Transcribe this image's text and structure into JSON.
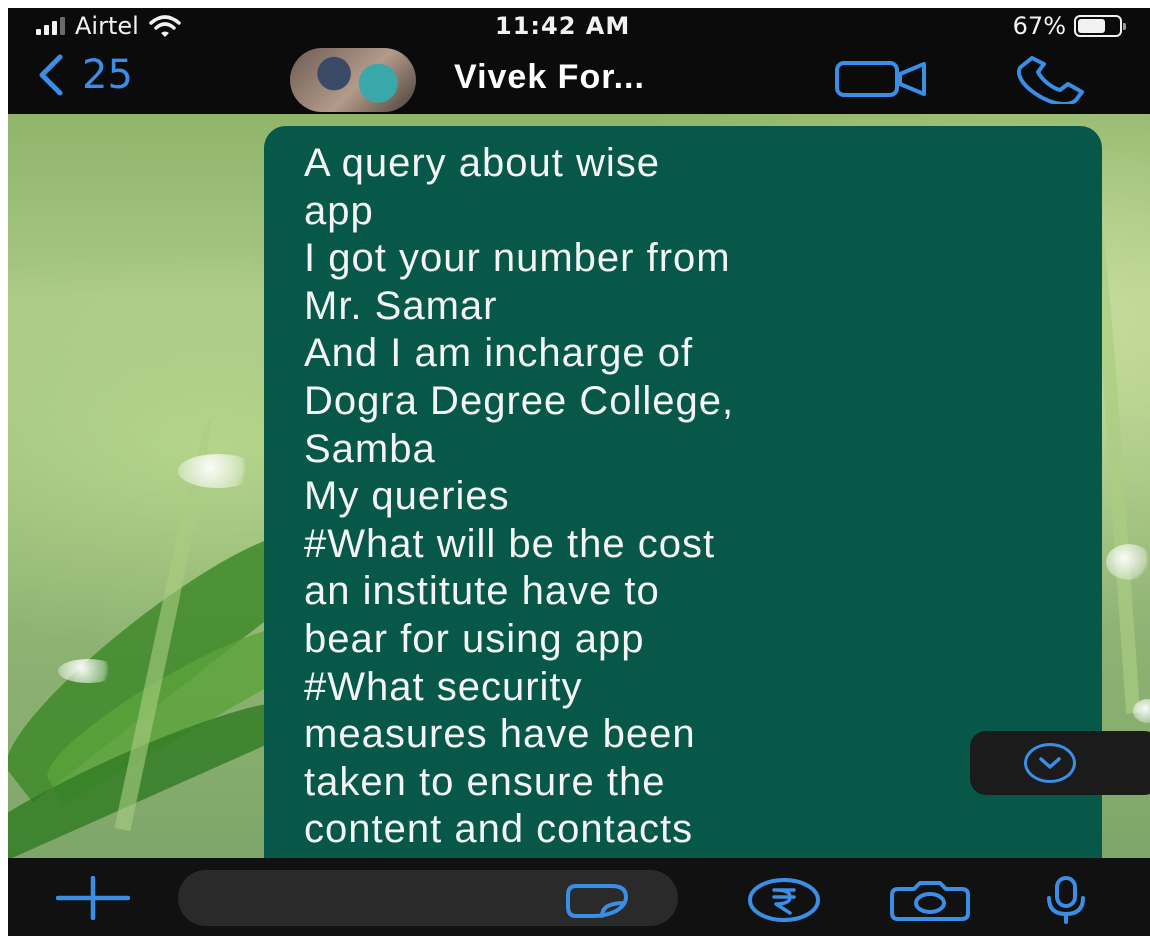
{
  "status_bar": {
    "carrier": "Airtel",
    "time": "11:42 AM",
    "battery_percent": "67%",
    "battery_level": 0.67
  },
  "header": {
    "back_count": "25",
    "contact_name": "Vivek For..."
  },
  "message": {
    "lines": [
      "A query about wise",
      "app",
      "I got your number from",
      "Mr. Samar",
      "And I am incharge of",
      "Dogra Degree College,",
      "Samba",
      "My queries",
      "#What will be the cost",
      "an institute have to",
      "bear for using app",
      "#What security",
      "measures have been",
      "taken to ensure the",
      "content and contacts"
    ]
  },
  "input": {
    "placeholder": ""
  },
  "colors": {
    "accent_blue": "#3a8ee6",
    "bubble_green": "#075848",
    "bar_black": "#0b0b0b"
  },
  "icons": [
    "signal-icon",
    "wifi-icon",
    "battery-icon",
    "back-chevron-icon",
    "video-call-icon",
    "phone-call-icon",
    "chevron-down-icon",
    "plus-icon",
    "sticker-icon",
    "rupee-payment-icon",
    "camera-icon",
    "microphone-icon"
  ]
}
